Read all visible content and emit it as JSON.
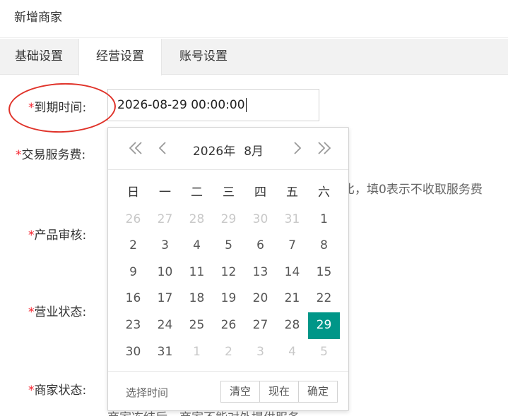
{
  "header": {
    "title": "新增商家"
  },
  "tabs": [
    {
      "label": "基础设置"
    },
    {
      "label": "经营设置"
    },
    {
      "label": "账号设置"
    }
  ],
  "form": {
    "required_mark": "*",
    "expire_label": "到期时间:",
    "expire_value": "2026-08-29 00:00:00",
    "service_fee_label": "交易服务费:",
    "service_fee_hint": "比，填0表示不收取服务费",
    "product_review_label": "产品审核:",
    "business_status_label": "营业状态:",
    "merchant_status_label": "商家状态:",
    "merchant_status_hint": "商家冻结后，商家不能对外提供服务"
  },
  "datepicker": {
    "year_label": "2026年",
    "month_label": "8月",
    "weekdays": [
      "日",
      "一",
      "二",
      "三",
      "四",
      "五",
      "六"
    ],
    "weeks": [
      [
        {
          "d": "26",
          "dim": true
        },
        {
          "d": "27",
          "dim": true
        },
        {
          "d": "28",
          "dim": true
        },
        {
          "d": "29",
          "dim": true
        },
        {
          "d": "30",
          "dim": true
        },
        {
          "d": "31",
          "dim": true
        },
        {
          "d": "1"
        }
      ],
      [
        {
          "d": "2"
        },
        {
          "d": "3"
        },
        {
          "d": "4"
        },
        {
          "d": "5"
        },
        {
          "d": "6"
        },
        {
          "d": "7"
        },
        {
          "d": "8"
        }
      ],
      [
        {
          "d": "9"
        },
        {
          "d": "10"
        },
        {
          "d": "11"
        },
        {
          "d": "12"
        },
        {
          "d": "13"
        },
        {
          "d": "14"
        },
        {
          "d": "15"
        }
      ],
      [
        {
          "d": "16"
        },
        {
          "d": "17"
        },
        {
          "d": "18"
        },
        {
          "d": "19"
        },
        {
          "d": "20"
        },
        {
          "d": "21"
        },
        {
          "d": "22"
        }
      ],
      [
        {
          "d": "23"
        },
        {
          "d": "24"
        },
        {
          "d": "25"
        },
        {
          "d": "26"
        },
        {
          "d": "27"
        },
        {
          "d": "28"
        },
        {
          "d": "29",
          "sel": true
        }
      ],
      [
        {
          "d": "30"
        },
        {
          "d": "31"
        },
        {
          "d": "1",
          "dim": true
        },
        {
          "d": "2",
          "dim": true
        },
        {
          "d": "3",
          "dim": true
        },
        {
          "d": "4",
          "dim": true
        },
        {
          "d": "5",
          "dim": true
        }
      ]
    ],
    "select_time_label": "选择时间",
    "clear_label": "清空",
    "now_label": "现在",
    "confirm_label": "确定"
  },
  "colors": {
    "selected_day": "#009688",
    "required": "#f5222d",
    "annotation_circle": "#e0332a"
  },
  "icons": {
    "prev_year": "double-chevron-left-icon",
    "prev_month": "chevron-left-icon",
    "next_month": "chevron-right-icon",
    "next_year": "double-chevron-right-icon"
  }
}
